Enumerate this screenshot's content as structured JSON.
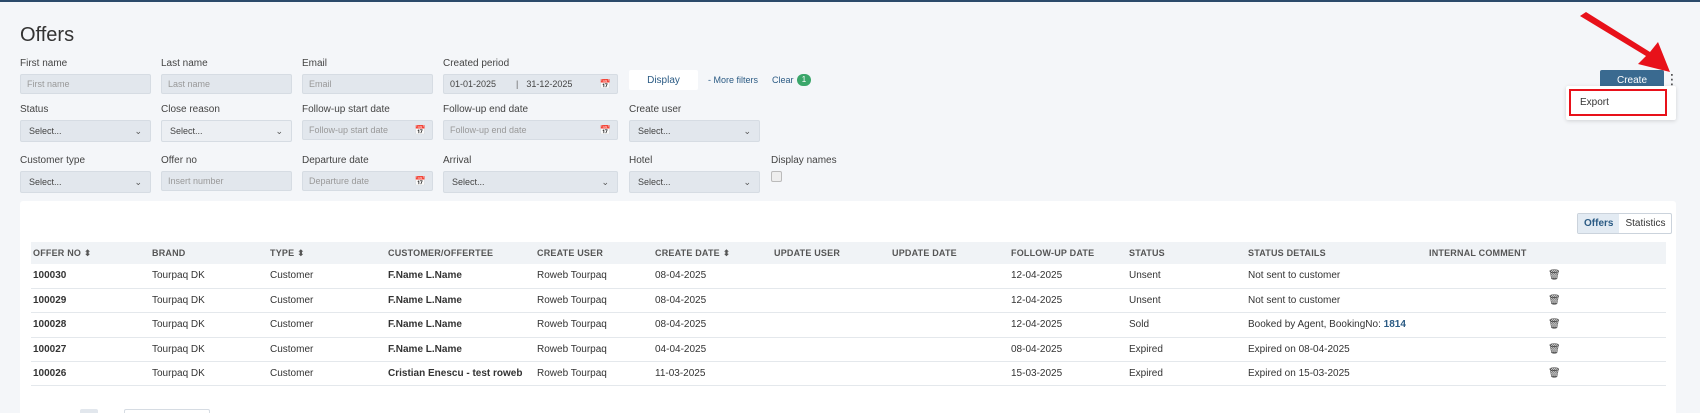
{
  "page": {
    "title": "Offers"
  },
  "filters": {
    "first_name": {
      "label": "First name",
      "placeholder": "First name"
    },
    "last_name": {
      "label": "Last name",
      "placeholder": "Last name"
    },
    "email": {
      "label": "Email",
      "placeholder": "Email"
    },
    "created_period": {
      "label": "Created period",
      "start": "01-01-2025",
      "separator": "|",
      "end": "31-12-2025"
    },
    "display_button": "Display",
    "more_filters": "- More filters",
    "clear": "Clear",
    "clear_count": "1",
    "status": {
      "label": "Status",
      "value": "Select..."
    },
    "close_reason": {
      "label": "Close reason",
      "value": "Select..."
    },
    "followup_start": {
      "label": "Follow-up start date",
      "placeholder": "Follow-up start date"
    },
    "followup_end": {
      "label": "Follow-up end date",
      "placeholder": "Follow-up end date"
    },
    "create_user": {
      "label": "Create user",
      "value": "Select..."
    },
    "customer_type": {
      "label": "Customer type",
      "value": "Select..."
    },
    "offer_no": {
      "label": "Offer no",
      "placeholder": "Insert number"
    },
    "departure_date": {
      "label": "Departure date",
      "placeholder": "Departure date"
    },
    "arrival": {
      "label": "Arrival",
      "value": "Select..."
    },
    "hotel": {
      "label": "Hotel",
      "value": "Select..."
    },
    "display_names": {
      "label": "Display names",
      "checked": false
    }
  },
  "actions": {
    "create_label": "Create",
    "menu_items": [
      "Export"
    ]
  },
  "annotation": {
    "color": "#e8111a"
  },
  "tabs": [
    "Offers",
    "Statistics"
  ],
  "table": {
    "columns": [
      "OFFER NO ⬍",
      "BRAND",
      "TYPE ⬍",
      "CUSTOMER/OFFERTEE",
      "CREATE USER",
      "CREATE DATE ⬍",
      "UPDATE USER",
      "UPDATE DATE",
      "FOLLOW-UP DATE",
      "STATUS",
      "STATUS DETAILS",
      "INTERNAL COMMENT"
    ],
    "rows": [
      {
        "offer_no": "100030",
        "brand": "Tourpaq DK",
        "type": "Customer",
        "customer": "F.Name L.Name",
        "create_user": "Roweb Tourpaq",
        "create_date": "08-04-2025",
        "update_user": "",
        "update_date": "",
        "followup": "12-04-2025",
        "status": "Unsent",
        "details": "Not sent to customer",
        "details_link": "",
        "comment": ""
      },
      {
        "offer_no": "100029",
        "brand": "Tourpaq DK",
        "type": "Customer",
        "customer": "F.Name L.Name",
        "create_user": "Roweb Tourpaq",
        "create_date": "08-04-2025",
        "update_user": "",
        "update_date": "",
        "followup": "12-04-2025",
        "status": "Unsent",
        "details": "Not sent to customer",
        "details_link": "",
        "comment": ""
      },
      {
        "offer_no": "100028",
        "brand": "Tourpaq DK",
        "type": "Customer",
        "customer": "F.Name L.Name",
        "create_user": "Roweb Tourpaq",
        "create_date": "08-04-2025",
        "update_user": "",
        "update_date": "",
        "followup": "12-04-2025",
        "status": "Sold",
        "details": "Booked by Agent, BookingNo: ",
        "details_link": "1814",
        "comment": ""
      },
      {
        "offer_no": "100027",
        "brand": "Tourpaq DK",
        "type": "Customer",
        "customer": "F.Name L.Name",
        "create_user": "Roweb Tourpaq",
        "create_date": "04-04-2025",
        "update_user": "",
        "update_date": "",
        "followup": "08-04-2025",
        "status": "Expired",
        "details": "Expired on 08-04-2025",
        "details_link": "",
        "comment": ""
      },
      {
        "offer_no": "100026",
        "brand": "Tourpaq DK",
        "type": "Customer",
        "customer": "Cristian Enescu - test roweb",
        "create_user": "Roweb Tourpaq",
        "create_date": "11-03-2025",
        "update_user": "",
        "update_date": "",
        "followup": "15-03-2025",
        "status": "Expired",
        "details": "Expired on 15-03-2025",
        "details_link": "",
        "comment": ""
      }
    ]
  }
}
